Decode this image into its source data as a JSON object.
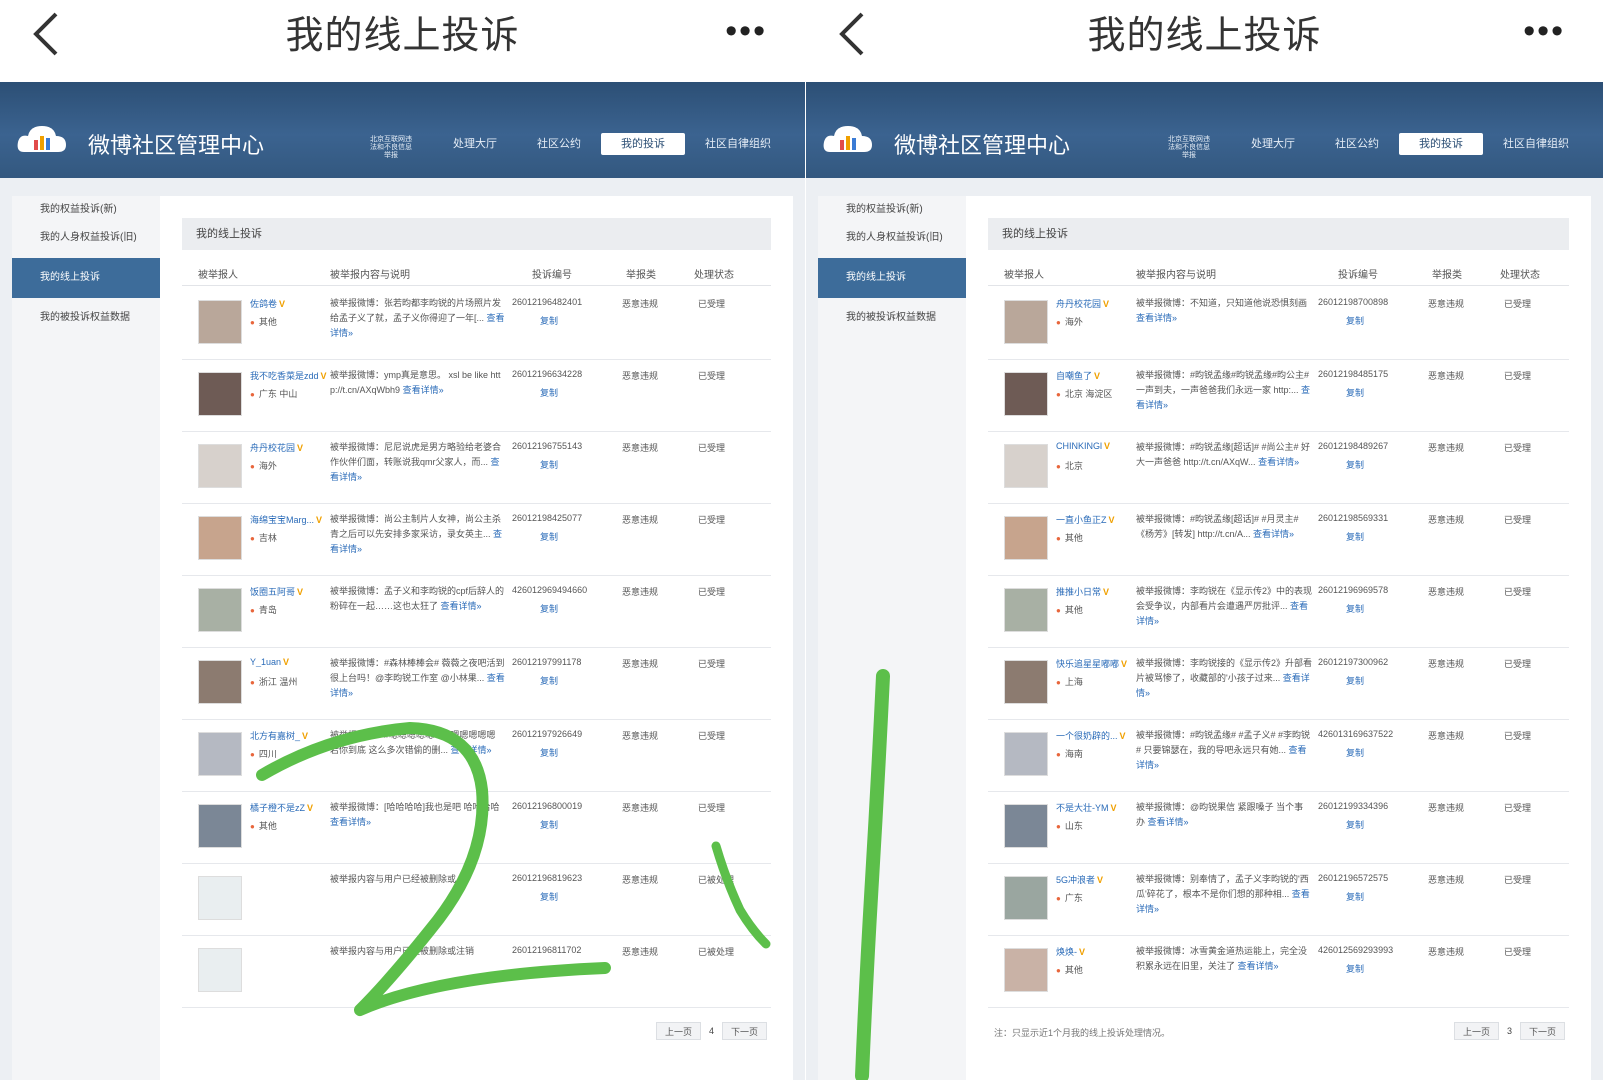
{
  "left": {
    "mobile_title": "我的线上投诉",
    "brand": "微博社区管理中心",
    "nav": [
      "北京互联网违法和不良信息举报",
      "处理大厅",
      "社区公约",
      "我的投诉",
      "社区自律组织"
    ],
    "side": [
      "我的权益投诉(新)",
      "我的人身权益投诉(旧)",
      "我的线上投诉",
      "我的被投诉权益数据"
    ],
    "main_title": "我的线上投诉",
    "headers": [
      "被举报人",
      "被举报内容与说明",
      "投诉编号",
      "举报类",
      "处理状态"
    ],
    "rows": [
      {
        "nick": "佐鸽卷",
        "loc": "其他",
        "desc": "被举报微博：张若昀都李昀锐的片场照片发给孟子义了就，孟子义你得迎了一年[...",
        "more": "查看详情»",
        "num": "26012196482401",
        "appeal": "复制",
        "cat": "恶意违规",
        "status": "已受理"
      },
      {
        "nick": "我不吃香菜是zdd",
        "loc": "广东 中山",
        "desc": "被举报微博：ymp真是意思。 xsl be like http://t.cn/AXqWbh9",
        "more": "查看详情»",
        "num": "26012196634228",
        "appeal": "复制",
        "cat": "恶意违规",
        "status": "已受理"
      },
      {
        "nick": "舟丹校花园",
        "loc": "海外",
        "desc": "被举报微博：尼尼说虎是男方略验给老婆合作伙伴们面，转账说我qmr父家人，而...",
        "more": "查看详情»",
        "num": "26012196755143",
        "appeal": "复制",
        "cat": "恶意违规",
        "status": "已受理"
      },
      {
        "nick": "海绵宝宝Marg...",
        "loc": "吉林",
        "desc": "被举报微博：尚公主制片人女神，尚公主杀青之后可以先安排多家采访，录女英主...",
        "more": "查看详情»",
        "num": "26012198425077",
        "appeal": "复制",
        "cat": "恶意违规",
        "status": "已受理"
      },
      {
        "nick": "饭圈五阿哥",
        "loc": "青岛",
        "desc": "被举报微博：孟子义和李昀锐的cpf后辞人的粉碎在一起……这也太狂了",
        "more": "查看详情»",
        "num": "426012969494660",
        "appeal": "复制",
        "cat": "恶意违规",
        "status": "已受理"
      },
      {
        "nick": "Y_1uan",
        "loc": "浙江 温州",
        "desc": "被举报微博：#森林棒棒会# 薇薇之夜吧活到很上台吗！@李昀锐工作室 @小林果...",
        "more": "查看详情»",
        "num": "26012197991178",
        "appeal": "复制",
        "cat": "恶意违规",
        "status": "已受理"
      },
      {
        "nick": "北方有嘉树_",
        "loc": "四川",
        "desc": "被举报微博：#嗯嗯嗯嗯嗯嗯# 嗯嗯嗯嗯嗯 若你到底 这么多次错偷的删...",
        "more": "查看详情»",
        "num": "26012197926649",
        "appeal": "复制",
        "cat": "恶意违规",
        "status": "已受理"
      },
      {
        "nick": "橘子橙不是zZ",
        "loc": "其他",
        "desc": "被举报微博：[哈哈哈哈]我也是吧 哈哈哈哈",
        "more": "查看详情»",
        "num": "26012196800019",
        "appeal": "复制",
        "cat": "恶意违规",
        "status": "已受理"
      },
      {
        "nick": "",
        "loc": "",
        "desc": "被举报内容与用户已经被删除或",
        "more": "",
        "num": "26012196819623",
        "appeal": "复制",
        "cat": "恶意违规",
        "status": "已被处理"
      },
      {
        "nick": "",
        "loc": "",
        "desc": "被举报内容与用户已经被删除或注销",
        "more": "",
        "num": "26012196811702",
        "appeal": "",
        "cat": "恶意违规",
        "status": "已被处理"
      }
    ],
    "pager": {
      "prev": "上一页",
      "page": "4",
      "next": "下一页"
    }
  },
  "right": {
    "mobile_title": "我的线上投诉",
    "brand": "微博社区管理中心",
    "nav": [
      "北京互联网违法和不良信息举报",
      "处理大厅",
      "社区公约",
      "我的投诉",
      "社区自律组织"
    ],
    "side": [
      "我的权益投诉(新)",
      "我的人身权益投诉(旧)",
      "我的线上投诉",
      "我的被投诉权益数据"
    ],
    "main_title": "我的线上投诉",
    "headers": [
      "被举报人",
      "被举报内容与说明",
      "投诉编号",
      "举报类",
      "处理状态"
    ],
    "rows": [
      {
        "nick": "舟丹校花园",
        "loc": "海外",
        "desc": "被举报微博：不知道，只知道他说恐惧刻画",
        "more": "查看详情»",
        "num": "26012198700898",
        "appeal": "复制",
        "cat": "恶意违规",
        "status": "已受理"
      },
      {
        "nick": "自嘲鱼了",
        "loc": "北京 海淀区",
        "desc": "被举报微博：#昀锐孟缘#昀锐孟缘#昀公主#一声到夫，一声爸爸我们永远一家 http:...",
        "more": "查看详情»",
        "num": "26012198485175",
        "appeal": "复制",
        "cat": "恶意违规",
        "status": "已受理"
      },
      {
        "nick": "CHINKINGl",
        "loc": "北京",
        "desc": "被举报微博：#昀锐孟缘[超话]# #尚公主# 好大一声爸爸 http://t.cn/AXqW...",
        "more": "查看详情»",
        "num": "26012198489267",
        "appeal": "复制",
        "cat": "恶意违规",
        "status": "已受理"
      },
      {
        "nick": "一直小鱼正Z",
        "loc": "其他",
        "desc": "被举报微博：#昀锐孟缘[超话]# #月灵主# 《杨芳》[转发] http://t.cn/A...",
        "more": "查看详情»",
        "num": "26012198569331",
        "appeal": "复制",
        "cat": "恶意违规",
        "status": "已受理"
      },
      {
        "nick": "推推小日常",
        "loc": "其他",
        "desc": "被举报微博：李昀锐在《显示传2》中的表现会受争议，内部看片会遭遇严厉批评...",
        "more": "查看详情»",
        "num": "26012196969578",
        "appeal": "复制",
        "cat": "恶意违规",
        "status": "已受理"
      },
      {
        "nick": "快乐追星星嘟嘟",
        "loc": "上海",
        "desc": "被举报微博：李昀锐接的《显示传2》升部看片被骂惨了，收藏部的'小孩子过来...",
        "more": "查看详情»",
        "num": "26012197300962",
        "appeal": "复制",
        "cat": "恶意违规",
        "status": "已受理"
      },
      {
        "nick": "一个很奶辟的...",
        "loc": "海南",
        "desc": "被举报微博：#昀锐孟缘# #孟子义# #李昀锐# 只要锦瑟在，我的导吧永远只有她...",
        "more": "查看详情»",
        "num": "426013169637522",
        "appeal": "复制",
        "cat": "恶意违规",
        "status": "已受理"
      },
      {
        "nick": "不是大壮-YM",
        "loc": "山东",
        "desc": "被举报微博：@昀锐果信 紧跟嗓子 当个事办",
        "more": "查看详情»",
        "num": "26012199334396",
        "appeal": "复制",
        "cat": "恶意违规",
        "status": "已受理"
      },
      {
        "nick": "5G冲浪者",
        "loc": "广东",
        "desc": "被举报微博：别奉情了，孟子义李昀锐的'西瓜'碎花了，根本不是你们想的那种相...",
        "more": "查看详情»",
        "num": "26012196572575",
        "appeal": "复制",
        "cat": "恶意违规",
        "status": "已受理"
      },
      {
        "nick": "焕焕-",
        "loc": "其他",
        "desc": "被举报微博：冰雪黄金道热运能上，完全没积累永远在旧里，关注了",
        "more": "查看详情»",
        "num": "426012569293993",
        "appeal": "复制",
        "cat": "恶意违规",
        "status": "已受理"
      }
    ],
    "note": "注：只显示近1个月我的线上投诉处理情况。",
    "pager": {
      "prev": "上一页",
      "page": "3",
      "next": "下一页"
    }
  }
}
